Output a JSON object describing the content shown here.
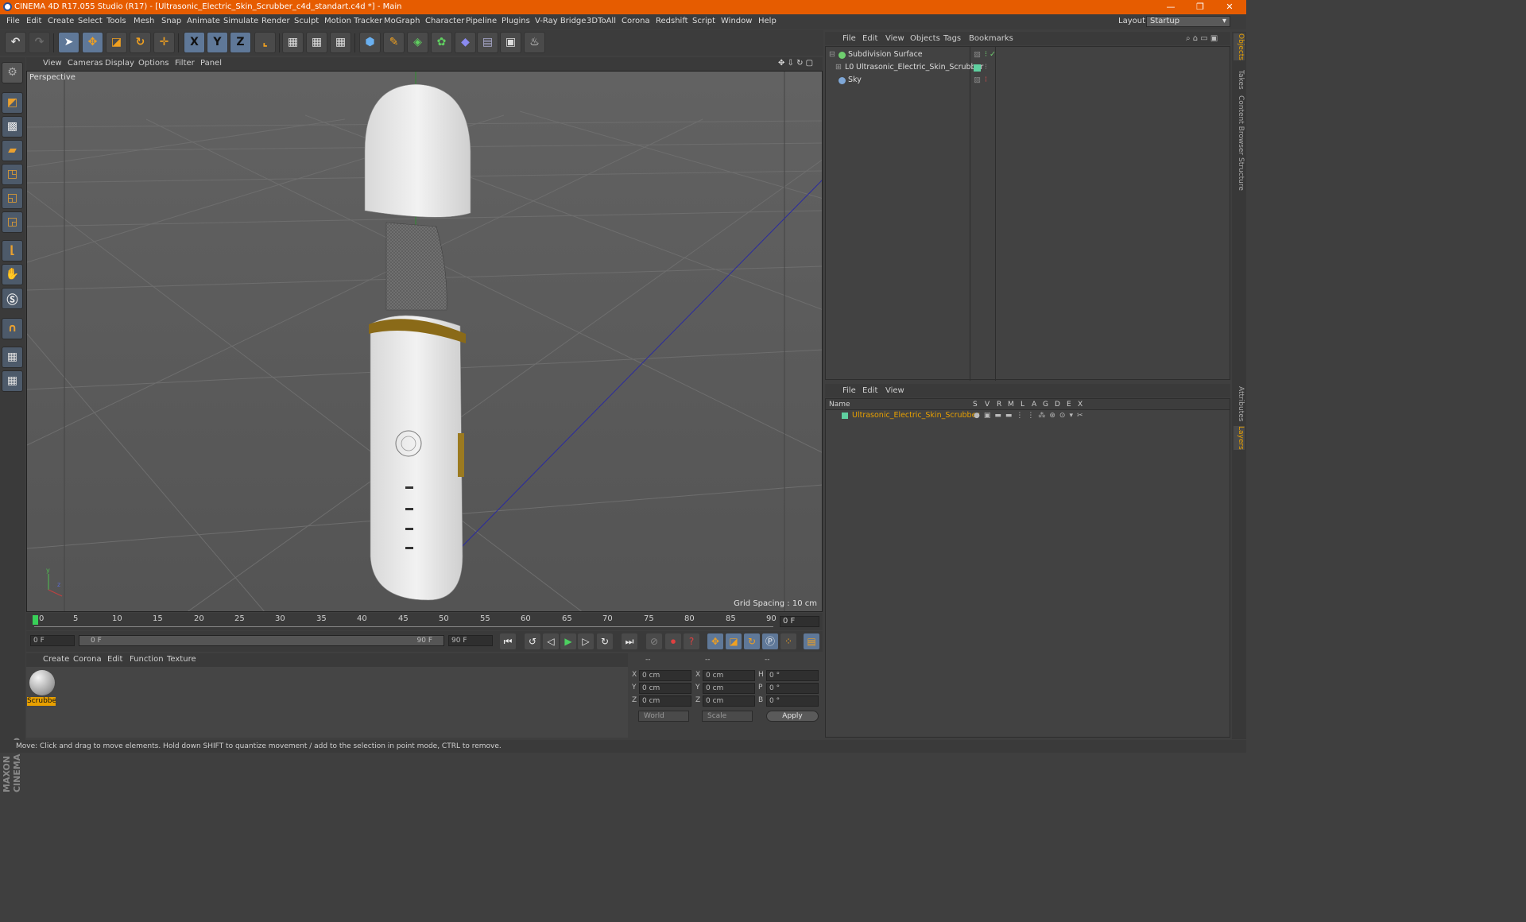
{
  "titlebar": {
    "title": "CINEMA 4D R17.055 Studio (R17) - [Ultrasonic_Electric_Skin_Scrubber_c4d_standart.c4d *] - Main",
    "minimize": "—",
    "restore": "❐",
    "close": "✕"
  },
  "menubar": {
    "items": [
      "File",
      "Edit",
      "Create",
      "Select",
      "Tools",
      "Mesh",
      "Snap",
      "Animate",
      "Simulate",
      "Render",
      "Sculpt",
      "Motion Tracker",
      "MoGraph",
      "Character",
      "Pipeline",
      "Plugins",
      "V-Ray Bridge",
      "3DToAll",
      "Corona",
      "Redshift",
      "Script",
      "Window",
      "Help"
    ],
    "layout_label": "Layout:",
    "layout_value": "Startup"
  },
  "toolbar": {
    "axis_x": "X",
    "axis_y": "Y",
    "axis_z": "Z"
  },
  "viewport": {
    "menu": [
      "View",
      "Cameras",
      "Display",
      "Options",
      "Filter",
      "Panel"
    ],
    "label": "Perspective",
    "grid_spacing": "Grid Spacing : 10 cm"
  },
  "timeline": {
    "ticks": [
      "0",
      "5",
      "10",
      "15",
      "20",
      "25",
      "30",
      "35",
      "40",
      "45",
      "50",
      "55",
      "60",
      "65",
      "70",
      "75",
      "80",
      "85",
      "90"
    ],
    "frame_field": "0 F",
    "start_field": "0 F",
    "range_start": "0 F",
    "range_end": "90 F",
    "end_field": "90 F"
  },
  "material_manager": {
    "menu": [
      "Create",
      "Corona",
      "Edit",
      "Function",
      "Texture"
    ],
    "material_name": "Scrubbe"
  },
  "coordinates": {
    "headers": [
      "--",
      "--",
      "--"
    ],
    "rows": [
      {
        "a": "X",
        "av": "0 cm",
        "b": "X",
        "bv": "0 cm",
        "c": "H",
        "cv": "0 °"
      },
      {
        "a": "Y",
        "av": "0 cm",
        "b": "Y",
        "bv": "0 cm",
        "c": "P",
        "cv": "0 °"
      },
      {
        "a": "Z",
        "av": "0 cm",
        "b": "Z",
        "bv": "0 cm",
        "c": "B",
        "cv": "0 °"
      }
    ],
    "space": "World",
    "mode": "Scale",
    "apply": "Apply"
  },
  "object_manager": {
    "menu": [
      "File",
      "Edit",
      "View",
      "Objects",
      "Tags",
      "Bookmarks"
    ],
    "objects": [
      {
        "name": "Subdivision Surface",
        "color": "#6fcf6f"
      },
      {
        "name": "Ultrasonic_Electric_Skin_Scrubber",
        "color": "#9ad0ff"
      },
      {
        "name": "Sky",
        "color": "#7fa8d8"
      }
    ]
  },
  "layer_manager": {
    "menu": [
      "File",
      "Edit",
      "View"
    ],
    "columns": [
      "Name",
      "S",
      "V",
      "R",
      "M",
      "L",
      "A",
      "G",
      "D",
      "E",
      "X"
    ],
    "layer_name": "Ultrasonic_Electric_Skin_Scrubber",
    "layer_color": "#5fd0a0"
  },
  "right_tabs": [
    "Objects",
    "Takes",
    "Content Browser",
    "Structure",
    "Attributes",
    "Layers"
  ],
  "status": "Move: Click and drag to move elements. Hold down SHIFT to quantize movement / add to the selection in point mode, CTRL to remove.",
  "brand": {
    "logo": "MAXON CINEMA 4D"
  },
  "colors": {
    "accent": "#e65c00",
    "selection": "#e8a000"
  }
}
